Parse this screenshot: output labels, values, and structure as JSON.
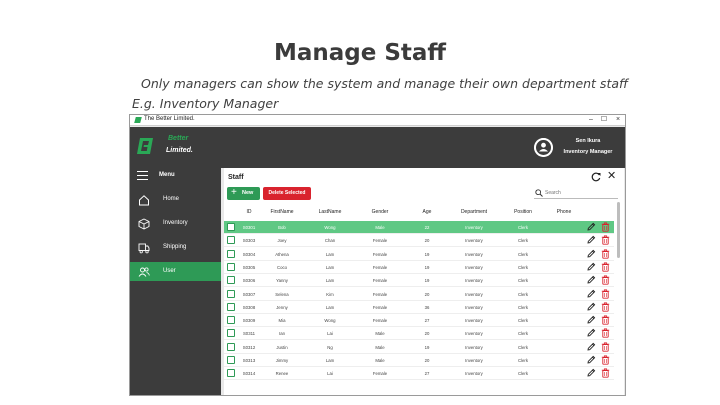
{
  "slide": {
    "title": "Manage Staff",
    "subtitle_line1": "Only managers can show the system and manage their own department staff",
    "subtitle_line2": "E.g. Inventory Manager"
  },
  "window": {
    "title": "The Better Limited.",
    "minimize": "–",
    "maximize": "☐",
    "close": "×"
  },
  "header": {
    "logo_line1": "Better",
    "logo_line2": "Limited.",
    "user_name": "Sen Ikura",
    "user_role": "Inventory Manager"
  },
  "sidebar": {
    "menu_label": "Menu",
    "items": [
      {
        "label": "Home",
        "icon": "home-icon",
        "active": false
      },
      {
        "label": "Inventory",
        "icon": "box-icon",
        "active": false
      },
      {
        "label": "Shipping",
        "icon": "truck-icon",
        "active": false
      },
      {
        "label": "User",
        "icon": "users-icon",
        "active": true
      }
    ]
  },
  "panel": {
    "title": "Staff",
    "new_label": "New",
    "delete_label": "Delete Selected",
    "search_placeholder": "Search",
    "columns": [
      "ID",
      "FirstName",
      "LastName",
      "Gender",
      "Age",
      "Department",
      "Position",
      "Phone"
    ],
    "rows": [
      {
        "id": "S0301",
        "first": "Bob",
        "last": "Wong",
        "gender": "Male",
        "age": "22",
        "dept": "Inventory",
        "pos": "Clerk",
        "phone": "",
        "selected": true
      },
      {
        "id": "S0303",
        "first": "Joey",
        "last": "Chan",
        "gender": "Female",
        "age": "20",
        "dept": "Inventory",
        "pos": "Clerk",
        "phone": "",
        "selected": false
      },
      {
        "id": "S0304",
        "first": "Athena",
        "last": "Lam",
        "gender": "Female",
        "age": "19",
        "dept": "Inventory",
        "pos": "Clerk",
        "phone": "",
        "selected": false
      },
      {
        "id": "S0305",
        "first": "Coco",
        "last": "Lam",
        "gender": "Female",
        "age": "19",
        "dept": "Inventory",
        "pos": "Clerk",
        "phone": "",
        "selected": false
      },
      {
        "id": "S0306",
        "first": "Yanny",
        "last": "Lam",
        "gender": "Female",
        "age": "19",
        "dept": "Inventory",
        "pos": "Clerk",
        "phone": "",
        "selected": false
      },
      {
        "id": "S0307",
        "first": "Selena",
        "last": "Kim",
        "gender": "Female",
        "age": "20",
        "dept": "Inventory",
        "pos": "Clerk",
        "phone": "",
        "selected": false
      },
      {
        "id": "S0308",
        "first": "Jenny",
        "last": "Lam",
        "gender": "Female",
        "age": "36",
        "dept": "Inventory",
        "pos": "Clerk",
        "phone": "",
        "selected": false
      },
      {
        "id": "S0309",
        "first": "Mia",
        "last": "Wong",
        "gender": "Female",
        "age": "27",
        "dept": "Inventory",
        "pos": "Clerk",
        "phone": "",
        "selected": false
      },
      {
        "id": "S0311",
        "first": "Ian",
        "last": "Lai",
        "gender": "Male",
        "age": "20",
        "dept": "Inventory",
        "pos": "Clerk",
        "phone": "",
        "selected": false
      },
      {
        "id": "S0312",
        "first": "Justin",
        "last": "Ng",
        "gender": "Male",
        "age": "19",
        "dept": "Inventory",
        "pos": "Clerk",
        "phone": "",
        "selected": false
      },
      {
        "id": "S0313",
        "first": "Jimmy",
        "last": "Lam",
        "gender": "Male",
        "age": "20",
        "dept": "Inventory",
        "pos": "Clerk",
        "phone": "",
        "selected": false
      },
      {
        "id": "S0314",
        "first": "Renee",
        "last": "Lai",
        "gender": "Female",
        "age": "27",
        "dept": "Inventory",
        "pos": "Clerk",
        "phone": "",
        "selected": false
      }
    ]
  },
  "colors": {
    "accent_green": "#2e9a56",
    "selected_row": "#5fc884",
    "delete_red": "#d9232e",
    "dark_chrome": "#3c3c3c"
  }
}
